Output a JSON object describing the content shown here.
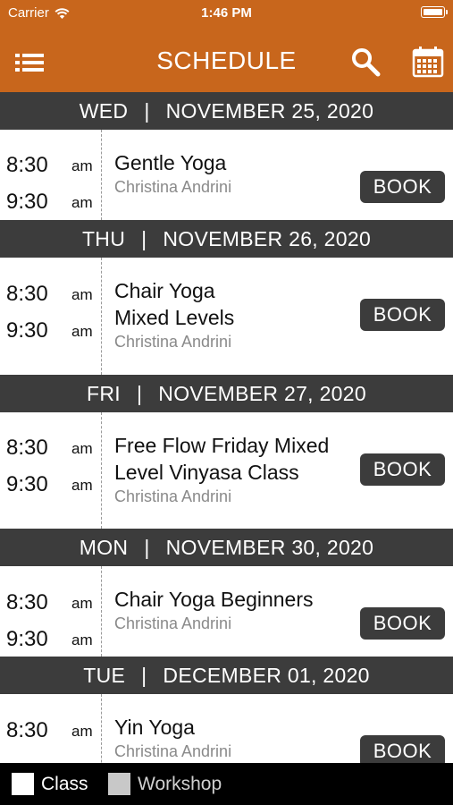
{
  "status_bar": {
    "carrier": "Carrier",
    "time": "1:46 PM"
  },
  "nav": {
    "title": "SCHEDULE",
    "menu_icon": "list-menu-icon",
    "search_icon": "search-icon",
    "calendar_icon": "calendar-icon"
  },
  "colors": {
    "brand": "#c8661c",
    "header_bg": "#3c3c3c",
    "button_bg": "#3c3c3c",
    "class_swatch": "#ffffff",
    "workshop_swatch": "#c8c8c8"
  },
  "days": [
    {
      "weekday": "WED",
      "date": "NOVEMBER 25, 2020",
      "classes": [
        {
          "start": "8:30",
          "start_ampm": "am",
          "end": "9:30",
          "end_ampm": "am",
          "name_lines": [
            "Gentle Yoga"
          ],
          "instructor": "Christina Andrini",
          "button": "BOOK"
        }
      ]
    },
    {
      "weekday": "THU",
      "date": "NOVEMBER 26, 2020",
      "classes": [
        {
          "start": "8:30",
          "start_ampm": "am",
          "end": "9:30",
          "end_ampm": "am",
          "name_lines": [
            "Chair Yoga",
            "Mixed Levels"
          ],
          "instructor": "Christina Andrini",
          "button": "BOOK"
        }
      ]
    },
    {
      "weekday": "FRI",
      "date": "NOVEMBER 27, 2020",
      "classes": [
        {
          "start": "8:30",
          "start_ampm": "am",
          "end": "9:30",
          "end_ampm": "am",
          "name_lines": [
            "Free Flow Friday Mixed",
            "Level Vinyasa Class"
          ],
          "instructor": "Christina Andrini",
          "button": "BOOK"
        }
      ]
    },
    {
      "weekday": "MON",
      "date": "NOVEMBER 30, 2020",
      "classes": [
        {
          "start": "8:30",
          "start_ampm": "am",
          "end": "9:30",
          "end_ampm": "am",
          "name_lines": [
            "Chair Yoga Beginners"
          ],
          "instructor": "Christina Andrini",
          "button": "BOOK"
        }
      ]
    },
    {
      "weekday": "TUE",
      "date": "DECEMBER 01, 2020",
      "classes": [
        {
          "start": "8:30",
          "start_ampm": "am",
          "end": "",
          "end_ampm": "",
          "name_lines": [
            "Yin Yoga"
          ],
          "instructor": "Christina Andrini",
          "button": "BOOK"
        }
      ]
    }
  ],
  "legend": {
    "class_label": "Class",
    "workshop_label": "Workshop"
  }
}
